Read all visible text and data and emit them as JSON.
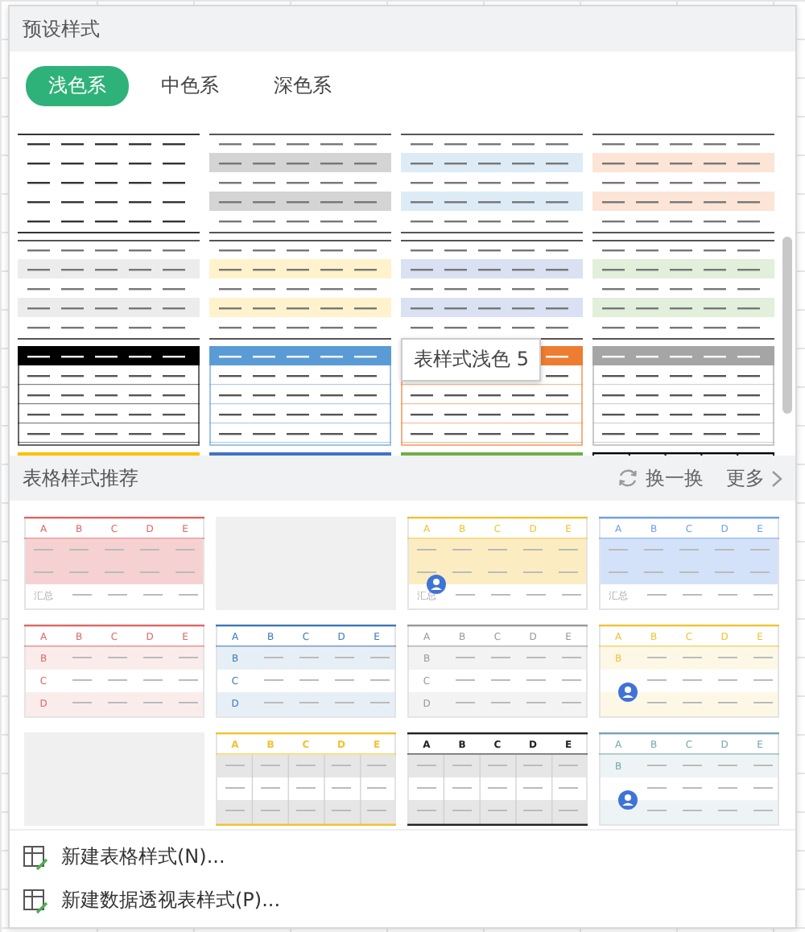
{
  "presets": {
    "title": "预设样式",
    "tabs": [
      {
        "label": "浅色系",
        "selected": true
      },
      {
        "label": "中色系",
        "selected": false
      },
      {
        "label": "深色系",
        "selected": false
      }
    ],
    "styles": [
      {
        "kind": "plain",
        "color": "#333333"
      },
      {
        "kind": "banded",
        "color": "#d4d4d4"
      },
      {
        "kind": "banded",
        "color": "#ddebf7"
      },
      {
        "kind": "banded",
        "color": "#fce4d6"
      },
      {
        "kind": "banded",
        "color": "#ececec"
      },
      {
        "kind": "banded",
        "color": "#fff2cc"
      },
      {
        "kind": "banded",
        "color": "#d9e1f2"
      },
      {
        "kind": "banded",
        "color": "#e2efda"
      },
      {
        "kind": "header",
        "color": "#000000"
      },
      {
        "kind": "header",
        "color": "#5b9bd5"
      },
      {
        "kind": "header",
        "color": "#ed7d31"
      },
      {
        "kind": "header",
        "color": "#a5a5a5"
      },
      {
        "kind": "header",
        "color": "#ffc000"
      },
      {
        "kind": "header",
        "color": "#4472c4"
      },
      {
        "kind": "header",
        "color": "#70ad47"
      },
      {
        "kind": "grid",
        "color": "#000000"
      }
    ],
    "tooltip": "表样式浅色 5"
  },
  "recommend": {
    "title": "表格样式推荐",
    "refresh": "换一换",
    "more": "更多",
    "cards": [
      {
        "kind": "total",
        "color": "#e06666",
        "headers": [
          "A",
          "B",
          "C",
          "D",
          "E"
        ],
        "total_label": "汇总",
        "premium": false
      },
      {
        "kind": "loading"
      },
      {
        "kind": "total",
        "color": "#f1c232",
        "headers": [
          "A",
          "B",
          "C",
          "D",
          "E"
        ],
        "total_label": "汇总",
        "premium": true
      },
      {
        "kind": "total",
        "color": "#6d9eeb",
        "headers": [
          "A",
          "B",
          "C",
          "D",
          "E"
        ],
        "total_label": "汇总",
        "premium": false
      },
      {
        "kind": "rows",
        "color": "#e06666",
        "headers": [
          "A",
          "B",
          "C",
          "D",
          "E"
        ],
        "row_labels": [
          "B",
          "C",
          "D"
        ],
        "premium": false
      },
      {
        "kind": "rows",
        "color": "#3d78b8",
        "headers": [
          "A",
          "B",
          "C",
          "D",
          "E"
        ],
        "row_labels": [
          "B",
          "C",
          "D"
        ],
        "premium": false
      },
      {
        "kind": "rows",
        "color": "#999999",
        "headers": [
          "A",
          "B",
          "C",
          "D",
          "E"
        ],
        "row_labels": [
          "B",
          "C",
          "D"
        ],
        "premium": false
      },
      {
        "kind": "rows",
        "color": "#f1c232",
        "headers": [
          "A",
          "B",
          "C",
          "D",
          "E"
        ],
        "row_labels": [
          "B"
        ],
        "premium": true
      },
      {
        "kind": "loading"
      },
      {
        "kind": "grid",
        "color": "#f1c232",
        "headers": [
          "A",
          "B",
          "C",
          "D",
          "E"
        ],
        "premium": false
      },
      {
        "kind": "grid",
        "color": "#222222",
        "headers": [
          "A",
          "B",
          "C",
          "D",
          "E"
        ],
        "premium": false
      },
      {
        "kind": "rows",
        "color": "#76a5af",
        "headers": [
          "A",
          "B",
          "C",
          "D",
          "E"
        ],
        "row_labels": [
          "B"
        ],
        "premium": true
      }
    ]
  },
  "actions": [
    {
      "label": "新建表格样式(N)..."
    },
    {
      "label": "新建数据透视表样式(P)..."
    }
  ]
}
